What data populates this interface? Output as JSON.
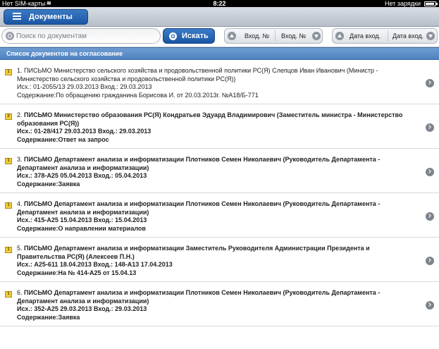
{
  "status": {
    "carrier": "Нет SIM-карты",
    "wifi": "wifi-icon",
    "time": "8:22",
    "charge": "Нет зарядки",
    "battery_level": 0.95
  },
  "nav": {
    "back_label": "Документы",
    "icon": "list-icon"
  },
  "toolbar": {
    "search_placeholder": "Поиск по документам",
    "search_button": "Искать",
    "sort_in_num_a": "Вход. №",
    "sort_in_num_b": "Вход. №",
    "sort_in_date_a": "Дата вход.",
    "sort_in_date_b": "Дата вход."
  },
  "section": {
    "title": "Список документов на согласование"
  },
  "documents": [
    {
      "priority": "1",
      "number": "1.",
      "title": "ПИСЬМО Министерство сельского хозяйства и продовольственной политики РС(Я) Слепцов Иван Иванович (Министр - Министерство сельского хозяйства и продовольственной политики РС(Я))",
      "refs": "Исх.: 01-2055/13 29.03.2013 Вход.: 29.03.2013",
      "content": "Содержание:По обращению гражданина Борисова И. от 20.03.2013г. №А18/Б-771",
      "bold": false
    },
    {
      "priority": "2",
      "number": "2.",
      "title": "ПИСЬМО Министерство образования РС(Я) Кондратьев Эдуард Владимирович (Заместитель министра - Министерство образования РС(Я))",
      "refs": "Исх.: 01-28/417 29.03.2013 Вход.: 29.03.2013",
      "content": "Содержание:Ответ на запрос",
      "bold": true
    },
    {
      "priority": "1",
      "number": "3.",
      "title": "ПИСЬМО Департамент анализа и информатизации Плотников Семен Николаевич (Руководитель Департамента - Департамент анализа и информатизации)",
      "refs": "Исх.: 378-А25 05.04.2013 Вход.: 05.04.2013",
      "content": "Содержание:Заявка",
      "bold": true
    },
    {
      "priority": "1",
      "number": "4.",
      "title": "ПИСЬМО Департамент анализа и информатизации Плотников Семен Николаевич (Руководитель Департамента - Департамент анализа и информатизации)",
      "refs": "Исх.: 415-А25 15.04.2013 Вход.: 15.04.2013",
      "content": "Содержание:О направлении материалов",
      "bold": true
    },
    {
      "priority": "1",
      "number": "5.",
      "title": "ПИСЬМО Департамент анализа и информатизации Заместитель Руководителя Администрации Президента и Правительства РС(Я) (Алексеев П.Н.)",
      "refs": "Исх.: А25-611 18.04.2013 Вход.: 148-А13 17.04.2013",
      "content": "Содержание:На № 414-А25 от 15.04.13",
      "bold": true
    },
    {
      "priority": "1",
      "number": "6.",
      "title": "ПИСЬМО Департамент анализа и информатизации Плотников Семен Николаевич (Руководитель Департамента - Департамент анализа и информатизации)",
      "refs": "Исх.: 352-А25 29.03.2013 Вход.: 29.03.2013",
      "content": "Содержание:Заявка",
      "bold": true
    }
  ]
}
